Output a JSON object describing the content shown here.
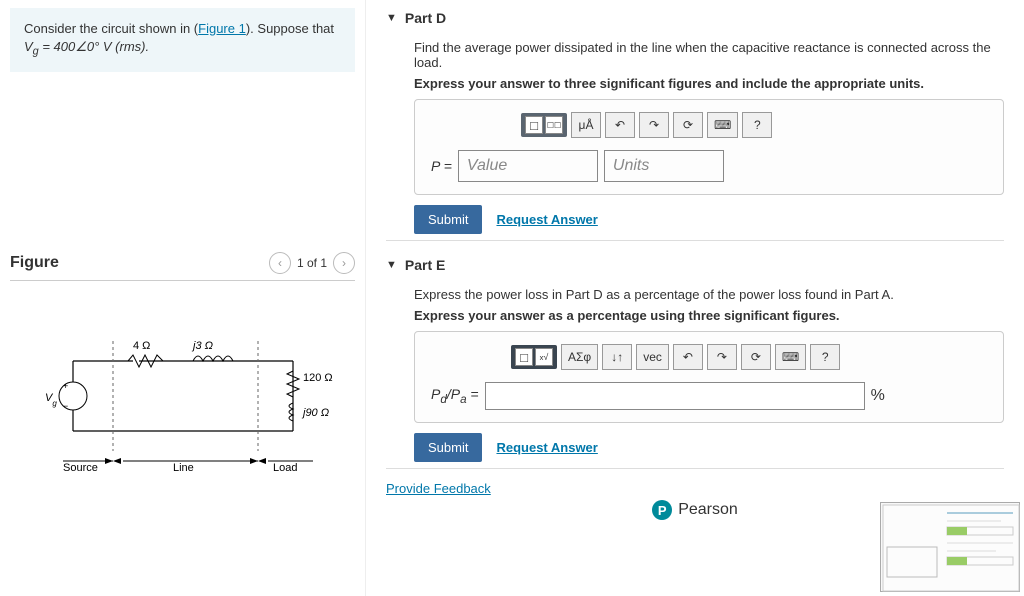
{
  "problem": {
    "intro_prefix": "Consider the circuit shown in (",
    "figure_link": "Figure 1",
    "intro_suffix": "). Suppose that",
    "equation": "V_g = 400∠0° V (rms)."
  },
  "figure": {
    "title": "Figure",
    "nav_text": "1 of 1",
    "labels": {
      "vg": "Vg",
      "r1": "4 Ω",
      "xl": "j3 Ω",
      "rl": "120 Ω",
      "xc": "j90 Ω",
      "source": "Source",
      "line": "Line",
      "load": "Load"
    }
  },
  "partD": {
    "title": "Part D",
    "prompt": "Find the average power dissipated in the line when the capacitive reactance is connected across the load.",
    "instruction": "Express your answer to three significant figures and include the appropriate units.",
    "label": "P =",
    "value_ph": "Value",
    "units_ph": "Units",
    "submit": "Submit",
    "request": "Request Answer",
    "tool_units": "μÅ",
    "tool_help": "?"
  },
  "partE": {
    "title": "Part E",
    "prompt": "Express the power loss in Part D as a percentage of the power loss found in Part A.",
    "instruction": "Express your answer as a percentage using three significant figures.",
    "label": "Pd/Pa =",
    "unit_after": "%",
    "submit": "Submit",
    "request": "Request Answer",
    "tool_greek": "ΑΣφ",
    "tool_arrows": "↓↑",
    "tool_vec": "vec",
    "tool_help": "?"
  },
  "footer": {
    "feedback": "Provide Feedback",
    "brand": "Pearson"
  }
}
